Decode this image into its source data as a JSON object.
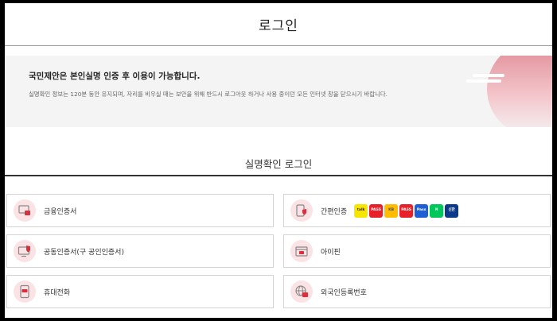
{
  "header": {
    "title": "로그인"
  },
  "notice": {
    "headline": "국민제안은 본인실명 인증 후 이용이 가능합니다.",
    "description": "실명확인 정보는 120분 동안 유지되며, 자리를 비우실 때는 보안을 위해 반드시 로그아웃 하거나 사용 중이던 모든 인터넷 창을 닫으시기 바랍니다."
  },
  "section": {
    "title": "실명확인 로그인"
  },
  "options": [
    {
      "label": "금융인증서",
      "icon": "financial-certificate-icon"
    },
    {
      "label": "간편인증",
      "icon": "simple-auth-icon"
    },
    {
      "label": "공동인증서(구 공인인증서)",
      "icon": "joint-certificate-icon"
    },
    {
      "label": "아이핀",
      "icon": "ipin-icon"
    },
    {
      "label": "휴대전화",
      "icon": "mobile-phone-icon"
    },
    {
      "label": "외국인등록번호",
      "icon": "foreigner-registration-icon"
    }
  ],
  "providers": [
    {
      "name": "kakao-talk",
      "text": "talk",
      "color": "#f7e600",
      "text_color": "#3a1d1d"
    },
    {
      "name": "pass",
      "text": "PASS",
      "color": "#e8202a",
      "text_color": "#ffffff"
    },
    {
      "name": "kb",
      "text": "KB",
      "color": "#ffbc00",
      "text_color": "#54493f"
    },
    {
      "name": "samsung-pass",
      "text": "PASS",
      "color": "#e8202a",
      "text_color": "#ffffff"
    },
    {
      "name": "payco-pass",
      "text": "Pass",
      "color": "#1f5fd6",
      "text_color": "#ffffff"
    },
    {
      "name": "naver",
      "text": "N",
      "color": "#03c75a",
      "text_color": "#ffffff"
    },
    {
      "name": "shinhan",
      "text": "신한",
      "color": "#0b3a8a",
      "text_color": "#ffffff"
    }
  ],
  "colors": {
    "accent": "#d9303e",
    "icon_bg": "#fbe3e5"
  }
}
